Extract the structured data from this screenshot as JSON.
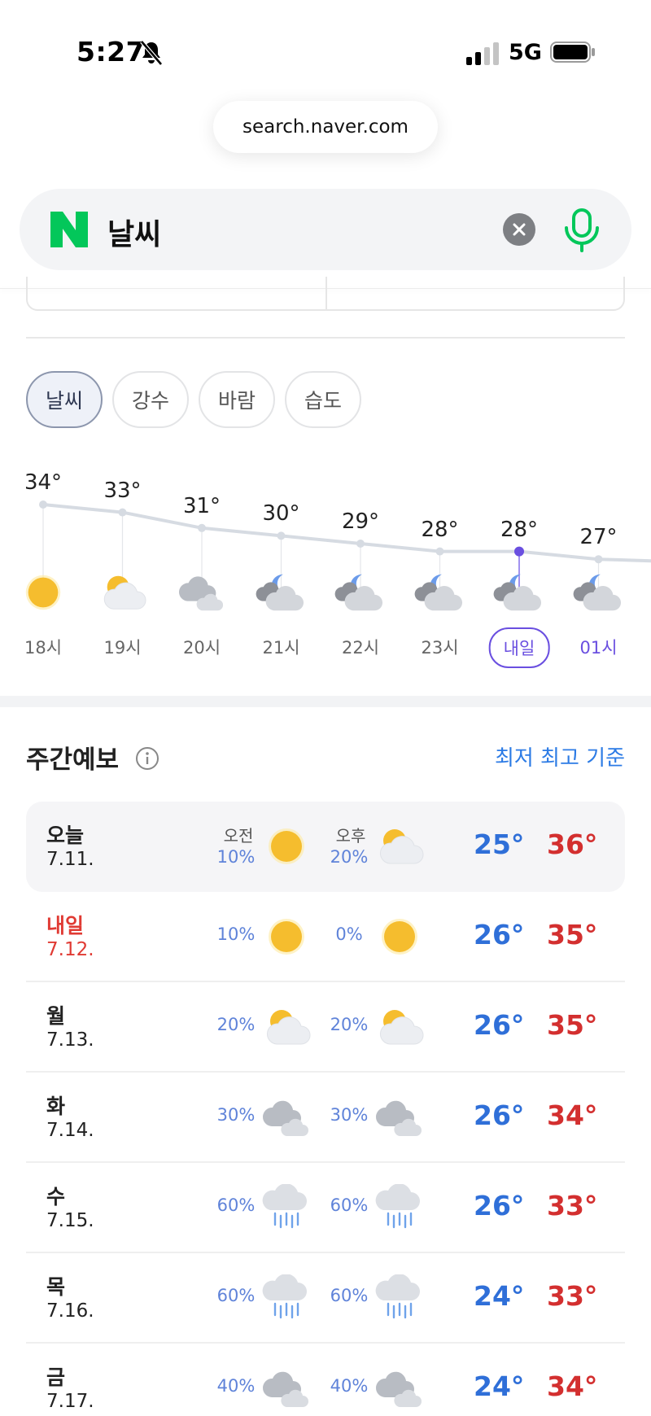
{
  "status_bar": {
    "time": "5:27",
    "network": "5G"
  },
  "browser": {
    "url": "search.naver.com"
  },
  "search": {
    "query": "날씨"
  },
  "tabs": [
    {
      "label": "날씨",
      "active": true
    },
    {
      "label": "강수",
      "active": false
    },
    {
      "label": "바람",
      "active": false
    },
    {
      "label": "습도",
      "active": false
    }
  ],
  "hourly": [
    {
      "time": "18시",
      "temp": "34°",
      "value": 34,
      "icon": "sun-icon"
    },
    {
      "time": "19시",
      "temp": "33°",
      "value": 33,
      "icon": "partly-cloudy-icon"
    },
    {
      "time": "20시",
      "temp": "31°",
      "value": 31,
      "icon": "cloudy-icon"
    },
    {
      "time": "21시",
      "temp": "30°",
      "value": 30,
      "icon": "night-cloudy-icon"
    },
    {
      "time": "22시",
      "temp": "29°",
      "value": 29,
      "icon": "night-cloudy-icon"
    },
    {
      "time": "23시",
      "temp": "28°",
      "value": 28,
      "icon": "night-cloudy-icon"
    },
    {
      "time": "내일",
      "temp": "28°",
      "value": 28,
      "icon": "night-cloudy-icon"
    },
    {
      "time": "01시",
      "temp": "27°",
      "value": 27,
      "icon": "night-cloudy-icon"
    }
  ],
  "weekly": {
    "title": "주간예보",
    "basis": "최저 최고 기준",
    "am_label": "오전",
    "pm_label": "오후",
    "days": [
      {
        "day": "오늘",
        "date": "7.11.",
        "am_pop": "10%",
        "am_icon": "sun-icon",
        "pm_pop": "20%",
        "pm_icon": "partly-cloudy-icon",
        "low": "25°",
        "high": "36°"
      },
      {
        "day": "내일",
        "date": "7.12.",
        "am_pop": "10%",
        "am_icon": "sun-icon",
        "pm_pop": "0%",
        "pm_icon": "sun-icon",
        "low": "26°",
        "high": "35°"
      },
      {
        "day": "월",
        "date": "7.13.",
        "am_pop": "20%",
        "am_icon": "partly-cloudy-icon",
        "pm_pop": "20%",
        "pm_icon": "partly-cloudy-icon",
        "low": "26°",
        "high": "35°"
      },
      {
        "day": "화",
        "date": "7.14.",
        "am_pop": "30%",
        "am_icon": "cloudy-icon",
        "pm_pop": "30%",
        "pm_icon": "cloudy-icon",
        "low": "26°",
        "high": "34°"
      },
      {
        "day": "수",
        "date": "7.15.",
        "am_pop": "60%",
        "am_icon": "rain-icon",
        "pm_pop": "60%",
        "pm_icon": "rain-icon",
        "low": "26°",
        "high": "33°"
      },
      {
        "day": "목",
        "date": "7.16.",
        "am_pop": "60%",
        "am_icon": "rain-icon",
        "pm_pop": "60%",
        "pm_icon": "rain-icon",
        "low": "24°",
        "high": "33°"
      },
      {
        "day": "금",
        "date": "7.17.",
        "am_pop": "40%",
        "am_icon": "cloudy-icon",
        "pm_pop": "40%",
        "pm_icon": "cloudy-icon",
        "low": "24°",
        "high": "34°"
      }
    ]
  },
  "colors": {
    "low": "#2f6fd8",
    "high": "#d32f2f",
    "accent": "#6a4fe0",
    "naver_green": "#03c75a"
  }
}
